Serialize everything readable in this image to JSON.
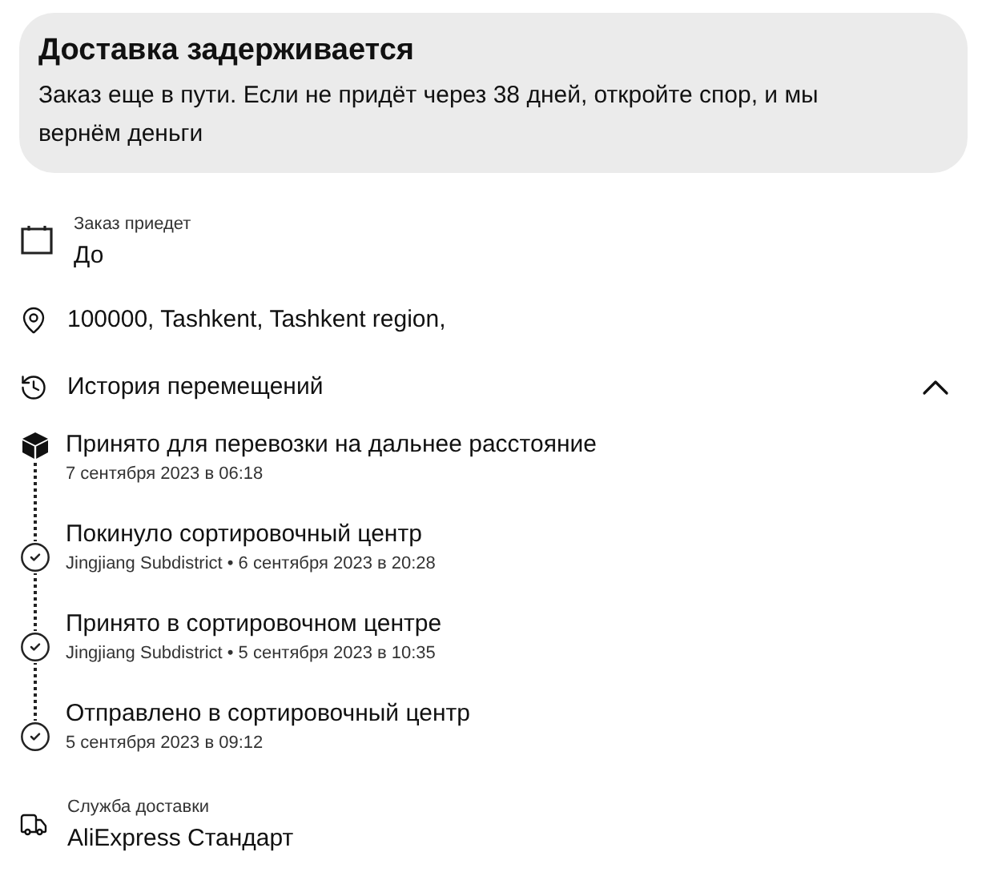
{
  "notice": {
    "title": "Доставка задерживается",
    "text": "Заказ еще в пути. Если не придёт через 38 дней, откройте спор, и мы вернём деньги"
  },
  "arrival": {
    "label": "Заказ приедет",
    "value": "До"
  },
  "address": "100000, Tashkent, Tashkent region,",
  "history": {
    "title": "История перемещений",
    "expanded": true,
    "events": [
      {
        "kind": "latest",
        "title": "Принято для перевозки на дальнее расстояние",
        "date": "7 сентября 2023 в 06:18"
      },
      {
        "kind": "done",
        "title": "Покинуло сортировочный центр",
        "date": "Jingjiang Subdistrict • 6 сентября 2023 в 20:28"
      },
      {
        "kind": "done",
        "title": "Принято в сортировочном центре",
        "date": "Jingjiang Subdistrict • 5 сентября 2023 в 10:35"
      },
      {
        "kind": "done",
        "title": "Отправлено в сортировочный центр",
        "date": "5 сентября 2023 в 09:12"
      }
    ]
  },
  "delivery": {
    "label": "Служба доставки",
    "value": "AliExpress Стандарт"
  }
}
